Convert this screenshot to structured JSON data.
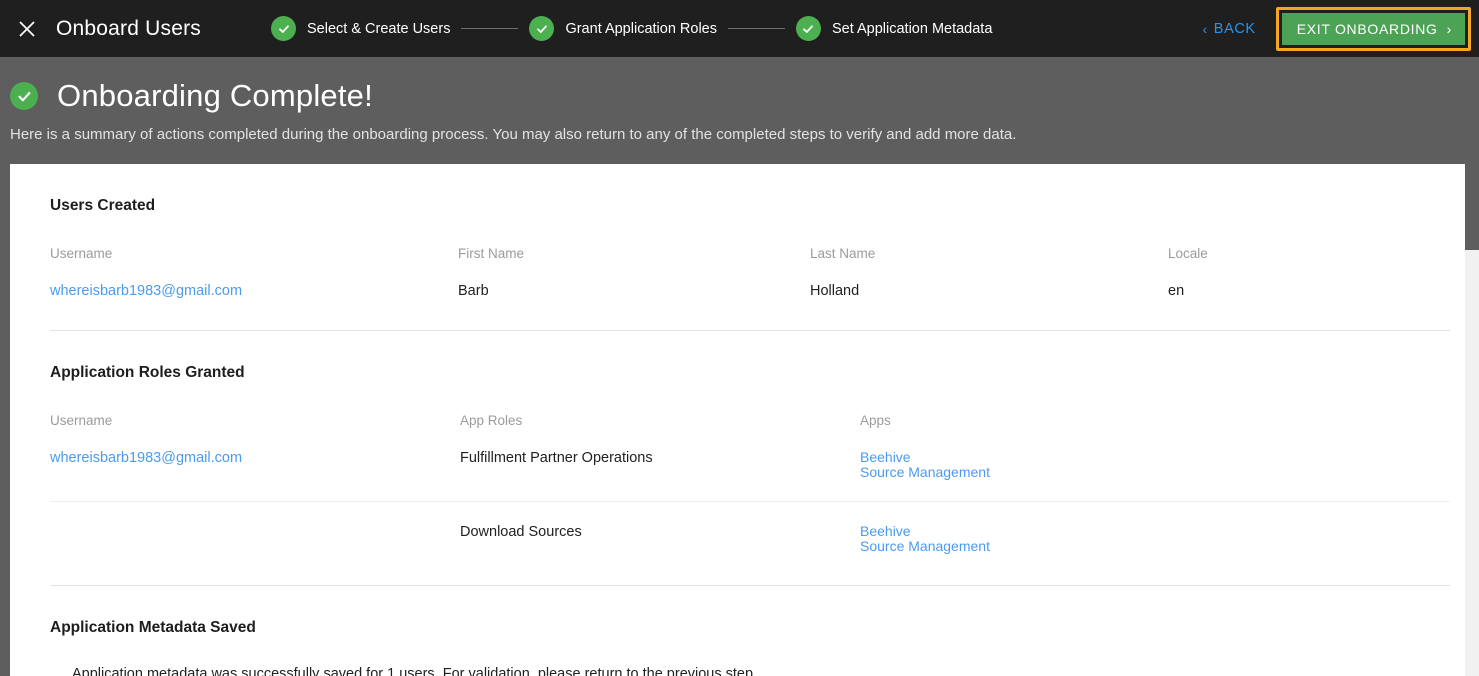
{
  "topbar": {
    "close_icon": "close-icon",
    "title": "Onboard Users",
    "steps": [
      {
        "label": "Select & Create Users",
        "state": "complete"
      },
      {
        "label": "Grant Application Roles",
        "state": "complete"
      },
      {
        "label": "Set Application Metadata",
        "state": "complete"
      }
    ],
    "back_label": "BACK",
    "back_chevron": "‹",
    "exit_label": "EXIT ONBOARDING",
    "exit_chevron": "›",
    "colors": {
      "bar_background": "#1f1f1f",
      "step_complete": "#4caf50",
      "link": "#2196f3",
      "exit_button": "#4ca355",
      "exit_highlight": "#f5a623"
    }
  },
  "banner": {
    "title": "Onboarding Complete!",
    "subtitle": "Here is a summary of actions completed during the onboarding process. You may also return to any of the completed steps to verify and add more data.",
    "check_icon": "check-circle-icon",
    "background": "#5e5e5e"
  },
  "sections": {
    "users_created": {
      "title": "Users Created",
      "columns": [
        "Username",
        "First Name",
        "Last Name",
        "Locale"
      ],
      "rows": [
        {
          "username": "whereisbarb1983@gmail.com",
          "first_name": "Barb",
          "last_name": "Holland",
          "locale": "en"
        }
      ]
    },
    "roles_granted": {
      "title": "Application Roles Granted",
      "columns": [
        "Username",
        "App Roles",
        "Apps"
      ],
      "rows": [
        {
          "username": "whereisbarb1983@gmail.com",
          "app_role": "Fulfillment Partner Operations",
          "apps": [
            "Beehive",
            "Source Management"
          ]
        },
        {
          "username": "",
          "app_role": "Download Sources",
          "apps": [
            "Beehive",
            "Source Management"
          ]
        }
      ]
    },
    "metadata_saved": {
      "title": "Application Metadata Saved",
      "message": "Application metadata was successfully saved for 1 users. For validation, please return to the previous step."
    }
  }
}
